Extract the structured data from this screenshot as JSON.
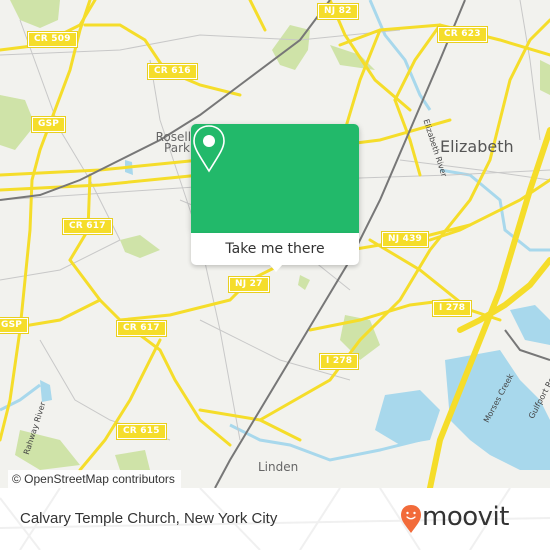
{
  "map": {
    "road_shields": [
      {
        "id": "cr509",
        "label": "CR 509"
      },
      {
        "id": "cr616",
        "label": "CR 616"
      },
      {
        "id": "nj82",
        "label": "NJ 82"
      },
      {
        "id": "cr623",
        "label": "CR 623"
      },
      {
        "id": "gsp1",
        "label": "GSP"
      },
      {
        "id": "gsp2",
        "label": "GSP"
      },
      {
        "id": "cr617a",
        "label": "CR 617"
      },
      {
        "id": "cr617b",
        "label": "CR 617"
      },
      {
        "id": "nj439",
        "label": "NJ 439"
      },
      {
        "id": "nj27",
        "label": "NJ 27"
      },
      {
        "id": "i278a",
        "label": "I 278"
      },
      {
        "id": "i278b",
        "label": "I 278"
      },
      {
        "id": "cr615",
        "label": "CR 615"
      }
    ],
    "places": {
      "elizabeth": "Elizabeth",
      "roselle_park": "Roselle Park",
      "linden": "Linden"
    },
    "water_labels": {
      "elizabeth_river": "Elizabeth River",
      "rahway_river": "Rahway River",
      "morses_creek": "Morses Creek",
      "gulfport_reach": "Gulfport Re..."
    },
    "attribution": "© OpenStreetMap contributors",
    "colors": {
      "background": "#f2f2ee",
      "road": "#f5dd2a",
      "water": "#a8d8ec",
      "park": "#cfe3a8",
      "rail": "#777777"
    }
  },
  "popup": {
    "button_label": "Take me there",
    "color": "#22b96a"
  },
  "footer": {
    "title": "Calvary Temple Church, New York City",
    "brand": "moovit",
    "brand_color": "#f26b3a"
  }
}
